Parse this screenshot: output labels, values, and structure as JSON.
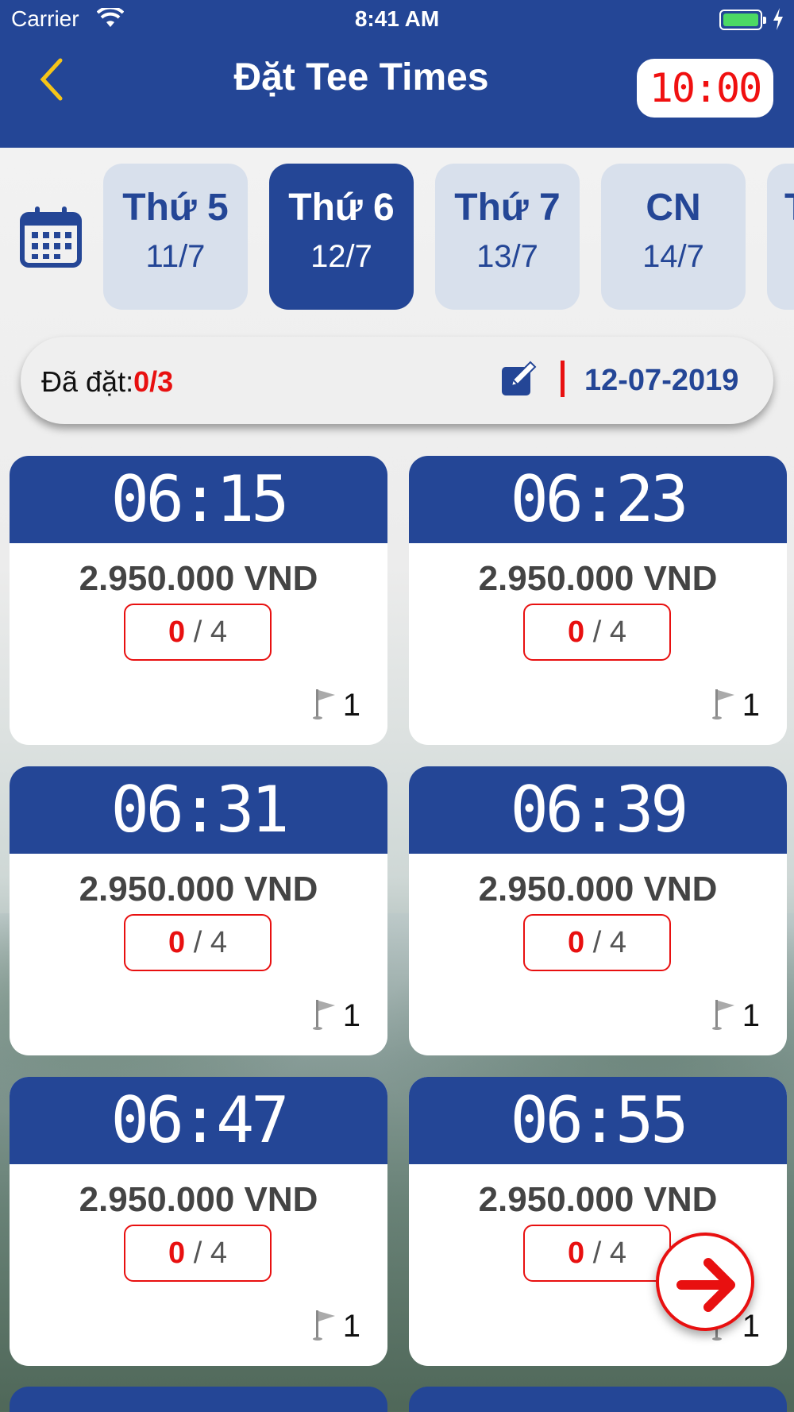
{
  "status_bar": {
    "carrier": "Carrier",
    "time": "8:41 AM"
  },
  "header": {
    "title": "Đặt Tee Times",
    "timer": "10:00"
  },
  "days": [
    {
      "name": "Thứ 5",
      "date": "11/7",
      "active": false
    },
    {
      "name": "Thứ 6",
      "date": "12/7",
      "active": true
    },
    {
      "name": "Thứ 7",
      "date": "13/7",
      "active": false
    },
    {
      "name": "CN",
      "date": "14/7",
      "active": false
    },
    {
      "name": "T",
      "date": "",
      "active": false
    }
  ],
  "booked": {
    "label": "Đã đặt:",
    "count": "0/3",
    "date": "12-07-2019"
  },
  "slots": [
    {
      "time": "06:15",
      "price": "2.950.000 VND",
      "booked": "0",
      "capacity": "/ 4",
      "hole": "1"
    },
    {
      "time": "06:23",
      "price": "2.950.000 VND",
      "booked": "0",
      "capacity": "/ 4",
      "hole": "1"
    },
    {
      "time": "06:31",
      "price": "2.950.000 VND",
      "booked": "0",
      "capacity": "/ 4",
      "hole": "1"
    },
    {
      "time": "06:39",
      "price": "2.950.000 VND",
      "booked": "0",
      "capacity": "/ 4",
      "hole": "1"
    },
    {
      "time": "06:47",
      "price": "2.950.000 VND",
      "booked": "0",
      "capacity": "/ 4",
      "hole": "1"
    },
    {
      "time": "06:55",
      "price": "2.950.000 VND",
      "booked": "0",
      "capacity": "/ 4",
      "hole": "1"
    }
  ],
  "colors": {
    "primary": "#244696",
    "accent_red": "#e81010",
    "chip_inactive": "#d8e0ec"
  }
}
